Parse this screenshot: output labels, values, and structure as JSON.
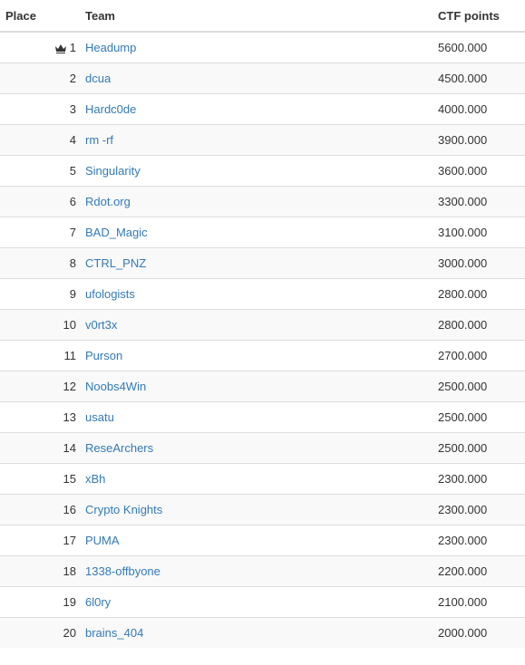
{
  "header": {
    "place": "Place",
    "team": "Team",
    "points": "CTF points"
  },
  "icons": {
    "winner": "crown-icon"
  },
  "colors": {
    "link": "#337ab7",
    "stripe": "#f9f9f9",
    "border": "#dddddd"
  },
  "rows": [
    {
      "place": "1",
      "team": "Headump",
      "points": "5600.000"
    },
    {
      "place": "2",
      "team": "dcua",
      "points": "4500.000"
    },
    {
      "place": "3",
      "team": "Hardc0de",
      "points": "4000.000"
    },
    {
      "place": "4",
      "team": "rm -rf",
      "points": "3900.000"
    },
    {
      "place": "5",
      "team": "Singularity",
      "points": "3600.000"
    },
    {
      "place": "6",
      "team": "Rdot.org",
      "points": "3300.000"
    },
    {
      "place": "7",
      "team": "BAD_Magic",
      "points": "3100.000"
    },
    {
      "place": "8",
      "team": "CTRL_PNZ",
      "points": "3000.000"
    },
    {
      "place": "9",
      "team": "ufologists",
      "points": "2800.000"
    },
    {
      "place": "10",
      "team": "v0rt3x",
      "points": "2800.000"
    },
    {
      "place": "11",
      "team": "Purson",
      "points": "2700.000"
    },
    {
      "place": "12",
      "team": "Noobs4Win",
      "points": "2500.000"
    },
    {
      "place": "13",
      "team": "usatu",
      "points": "2500.000"
    },
    {
      "place": "14",
      "team": "ReseArchers",
      "points": "2500.000"
    },
    {
      "place": "15",
      "team": "xBh",
      "points": "2300.000"
    },
    {
      "place": "16",
      "team": "Crypto Knights",
      "points": "2300.000"
    },
    {
      "place": "17",
      "team": "PUMA",
      "points": "2300.000"
    },
    {
      "place": "18",
      "team": "1338-offbyone",
      "points": "2200.000"
    },
    {
      "place": "19",
      "team": "6l0ry",
      "points": "2100.000"
    },
    {
      "place": "20",
      "team": "brains_404",
      "points": "2000.000"
    }
  ]
}
